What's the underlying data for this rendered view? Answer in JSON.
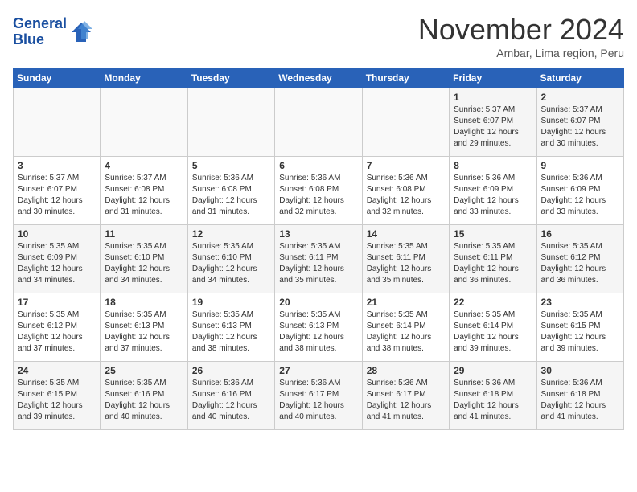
{
  "logo": {
    "line1": "General",
    "line2": "Blue"
  },
  "title": "November 2024",
  "location": "Ambar, Lima region, Peru",
  "days_of_week": [
    "Sunday",
    "Monday",
    "Tuesday",
    "Wednesday",
    "Thursday",
    "Friday",
    "Saturday"
  ],
  "weeks": [
    [
      {
        "day": "",
        "info": ""
      },
      {
        "day": "",
        "info": ""
      },
      {
        "day": "",
        "info": ""
      },
      {
        "day": "",
        "info": ""
      },
      {
        "day": "",
        "info": ""
      },
      {
        "day": "1",
        "info": "Sunrise: 5:37 AM\nSunset: 6:07 PM\nDaylight: 12 hours and 29 minutes."
      },
      {
        "day": "2",
        "info": "Sunrise: 5:37 AM\nSunset: 6:07 PM\nDaylight: 12 hours and 30 minutes."
      }
    ],
    [
      {
        "day": "3",
        "info": "Sunrise: 5:37 AM\nSunset: 6:07 PM\nDaylight: 12 hours and 30 minutes."
      },
      {
        "day": "4",
        "info": "Sunrise: 5:37 AM\nSunset: 6:08 PM\nDaylight: 12 hours and 31 minutes."
      },
      {
        "day": "5",
        "info": "Sunrise: 5:36 AM\nSunset: 6:08 PM\nDaylight: 12 hours and 31 minutes."
      },
      {
        "day": "6",
        "info": "Sunrise: 5:36 AM\nSunset: 6:08 PM\nDaylight: 12 hours and 32 minutes."
      },
      {
        "day": "7",
        "info": "Sunrise: 5:36 AM\nSunset: 6:08 PM\nDaylight: 12 hours and 32 minutes."
      },
      {
        "day": "8",
        "info": "Sunrise: 5:36 AM\nSunset: 6:09 PM\nDaylight: 12 hours and 33 minutes."
      },
      {
        "day": "9",
        "info": "Sunrise: 5:36 AM\nSunset: 6:09 PM\nDaylight: 12 hours and 33 minutes."
      }
    ],
    [
      {
        "day": "10",
        "info": "Sunrise: 5:35 AM\nSunset: 6:09 PM\nDaylight: 12 hours and 34 minutes."
      },
      {
        "day": "11",
        "info": "Sunrise: 5:35 AM\nSunset: 6:10 PM\nDaylight: 12 hours and 34 minutes."
      },
      {
        "day": "12",
        "info": "Sunrise: 5:35 AM\nSunset: 6:10 PM\nDaylight: 12 hours and 34 minutes."
      },
      {
        "day": "13",
        "info": "Sunrise: 5:35 AM\nSunset: 6:11 PM\nDaylight: 12 hours and 35 minutes."
      },
      {
        "day": "14",
        "info": "Sunrise: 5:35 AM\nSunset: 6:11 PM\nDaylight: 12 hours and 35 minutes."
      },
      {
        "day": "15",
        "info": "Sunrise: 5:35 AM\nSunset: 6:11 PM\nDaylight: 12 hours and 36 minutes."
      },
      {
        "day": "16",
        "info": "Sunrise: 5:35 AM\nSunset: 6:12 PM\nDaylight: 12 hours and 36 minutes."
      }
    ],
    [
      {
        "day": "17",
        "info": "Sunrise: 5:35 AM\nSunset: 6:12 PM\nDaylight: 12 hours and 37 minutes."
      },
      {
        "day": "18",
        "info": "Sunrise: 5:35 AM\nSunset: 6:13 PM\nDaylight: 12 hours and 37 minutes."
      },
      {
        "day": "19",
        "info": "Sunrise: 5:35 AM\nSunset: 6:13 PM\nDaylight: 12 hours and 38 minutes."
      },
      {
        "day": "20",
        "info": "Sunrise: 5:35 AM\nSunset: 6:13 PM\nDaylight: 12 hours and 38 minutes."
      },
      {
        "day": "21",
        "info": "Sunrise: 5:35 AM\nSunset: 6:14 PM\nDaylight: 12 hours and 38 minutes."
      },
      {
        "day": "22",
        "info": "Sunrise: 5:35 AM\nSunset: 6:14 PM\nDaylight: 12 hours and 39 minutes."
      },
      {
        "day": "23",
        "info": "Sunrise: 5:35 AM\nSunset: 6:15 PM\nDaylight: 12 hours and 39 minutes."
      }
    ],
    [
      {
        "day": "24",
        "info": "Sunrise: 5:35 AM\nSunset: 6:15 PM\nDaylight: 12 hours and 39 minutes."
      },
      {
        "day": "25",
        "info": "Sunrise: 5:35 AM\nSunset: 6:16 PM\nDaylight: 12 hours and 40 minutes."
      },
      {
        "day": "26",
        "info": "Sunrise: 5:36 AM\nSunset: 6:16 PM\nDaylight: 12 hours and 40 minutes."
      },
      {
        "day": "27",
        "info": "Sunrise: 5:36 AM\nSunset: 6:17 PM\nDaylight: 12 hours and 40 minutes."
      },
      {
        "day": "28",
        "info": "Sunrise: 5:36 AM\nSunset: 6:17 PM\nDaylight: 12 hours and 41 minutes."
      },
      {
        "day": "29",
        "info": "Sunrise: 5:36 AM\nSunset: 6:18 PM\nDaylight: 12 hours and 41 minutes."
      },
      {
        "day": "30",
        "info": "Sunrise: 5:36 AM\nSunset: 6:18 PM\nDaylight: 12 hours and 41 minutes."
      }
    ]
  ]
}
